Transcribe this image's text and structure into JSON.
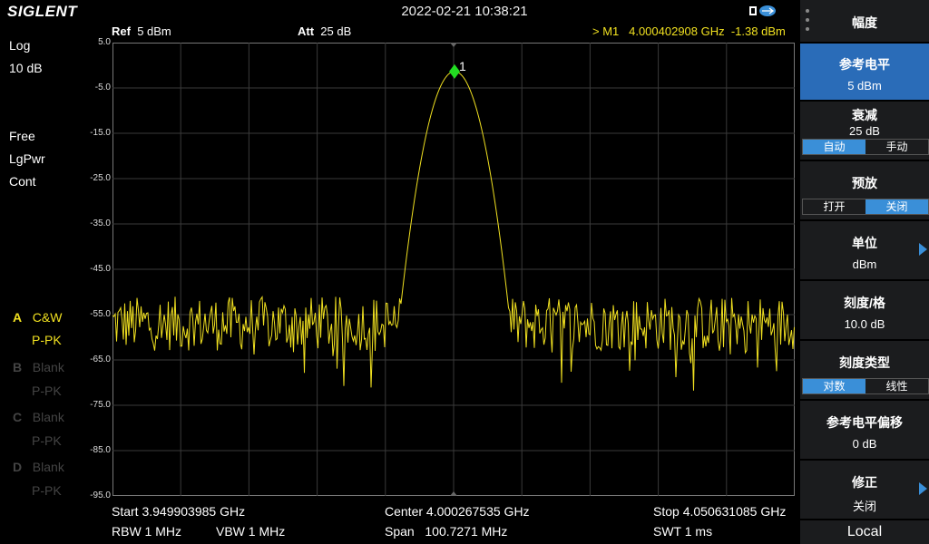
{
  "status": {
    "logo": "SIGLENT",
    "datetime": "2022-02-21 10:38:21"
  },
  "header": {
    "ref_label": "Ref",
    "ref_value": "5 dBm",
    "att_label": "Att",
    "att_value": "25 dB",
    "marker_readout": "> M1   4.000402908 GHz  -1.38 dBm"
  },
  "left": {
    "scale_type": "Log",
    "scale_div": "10 dB",
    "trig": "Free",
    "det": "LgPwr",
    "sweep": "Cont",
    "traces": [
      {
        "letter": "A",
        "mode": "C&W",
        "det": "P-PK",
        "active": true
      },
      {
        "letter": "B",
        "mode": "Blank",
        "det": "P-PK",
        "active": false
      },
      {
        "letter": "C",
        "mode": "Blank",
        "det": "P-PK",
        "active": false
      },
      {
        "letter": "D",
        "mode": "Blank",
        "det": "P-PK",
        "active": false
      }
    ]
  },
  "yaxis": {
    "ticks": [
      "5.0",
      "-5.0",
      "-15.0",
      "-25.0",
      "-35.0",
      "-45.0",
      "-55.0",
      "-65.0",
      "-75.0",
      "-85.0",
      "-95.0"
    ]
  },
  "marker": {
    "label": "1"
  },
  "footer": {
    "start": "Start  3.949903985 GHz",
    "center": "Center  4.000267535 GHz",
    "stop": "Stop  4.050631085 GHz",
    "rbw": "RBW  1 MHz",
    "vbw": "VBW  1 MHz",
    "span": "Span   100.7271 MHz",
    "swt": "SWT  1 ms"
  },
  "menu": {
    "title": "幅度",
    "ref_level": {
      "label": "参考电平",
      "value": "5 dBm"
    },
    "atten": {
      "label": "衰减",
      "value": "25 dB",
      "opt_auto": "自动",
      "opt_manual": "手动"
    },
    "preamp": {
      "label": "预放",
      "opt_on": "打开",
      "opt_off": "关闭"
    },
    "unit": {
      "label": "单位",
      "value": "dBm"
    },
    "scale_div": {
      "label": "刻度/格",
      "value": "10.0 dB"
    },
    "scale_type": {
      "label": "刻度类型",
      "opt_log": "对数",
      "opt_lin": "线性"
    },
    "ref_offset": {
      "label": "参考电平偏移",
      "value": "0 dB"
    },
    "correction": {
      "label": "修正",
      "value": "关闭"
    },
    "local": "Local"
  },
  "colors": {
    "trace": "#f0e020",
    "marker": "#22dd22",
    "accent": "#3a8fd8",
    "grid": "#3a3a3a"
  },
  "chart_data": {
    "type": "line",
    "xlabel": "",
    "ylabel": "",
    "x_range_ghz": [
      3.949903985,
      4.050631085
    ],
    "ylim": [
      -95,
      5
    ],
    "grid": true,
    "peak": {
      "x_ghz": 4.000402908,
      "y_dbm": -1.38
    },
    "noise_floor_dbm": -57
  }
}
